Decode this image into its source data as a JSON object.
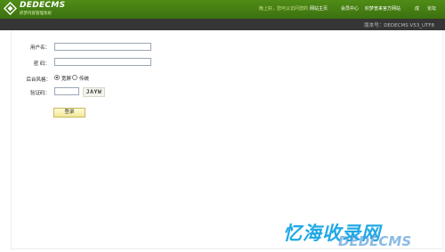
{
  "header": {
    "logo_text": "DEDECMS",
    "logo_subtitle": "织梦内容管理系统",
    "welcome": "晚上好，您可以访问您的",
    "nav": [
      "网站主页",
      "会员中心",
      "织梦普来官方网站",
      "成",
      "论坛"
    ]
  },
  "subbar": {
    "version": "版本号：DEDECMS V53_UTF8"
  },
  "form": {
    "username_label": "用户名：",
    "username_value": "",
    "password_label": "密    码：",
    "password_value": "",
    "style_label": "后台风格：",
    "style_options": [
      "宽屏",
      "传统"
    ],
    "style_selected": "宽屏",
    "captcha_label": "验证码：",
    "captcha_value": "",
    "captcha_image_text": "JAYW",
    "login_button": "登录"
  },
  "watermark": {
    "text": "忆海收录网",
    "overlay": "DEDECMS"
  },
  "colors": {
    "header_green": "#4a8614",
    "subbar_dark": "#353535",
    "watermark_blue": "#21a9e5"
  }
}
